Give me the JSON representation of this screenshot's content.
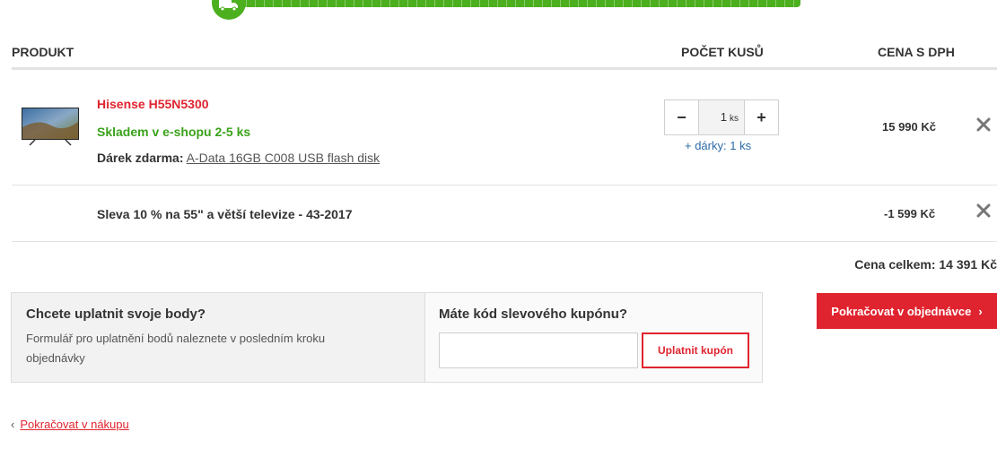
{
  "progress": {
    "step_icon": "truck-icon",
    "color": "#4caf1e",
    "fill": 1.0
  },
  "table_header": {
    "product": "PRODUKT",
    "quantity": "POČET KUSŮ",
    "price": "CENA S DPH"
  },
  "items": [
    {
      "name": "Hisense H55N5300",
      "stock": "Skladem v e-shopu 2-5 ks",
      "gift_label": "Dárek zdarma:",
      "gift_link": "A-Data 16GB C008 USB flash disk",
      "qty_minus": "−",
      "qty_value": "1",
      "qty_unit": "ks",
      "qty_plus": "+",
      "gifts_prefix": "+ dárky:",
      "gifts_count": "1 ks",
      "price": "15 990 Kč"
    }
  ],
  "discount": {
    "text": "Sleva 10 % na 55\" a větší televize - 43-2017",
    "price": "-1 599 Kč"
  },
  "total": "Cena celkem: 14 391 Kč",
  "points": {
    "title": "Chcete uplatnit svoje body?",
    "description": "Formulář pro uplatnění bodů naleznete v posledním kroku objednávky"
  },
  "coupon": {
    "title": "Máte kód slevového kupónu?",
    "input_value": "",
    "apply_label": "Uplatnit kupón"
  },
  "continue_order": {
    "label": "Pokračovat v objednávce",
    "chevron": "›"
  },
  "continue_shopping": {
    "chevron": "‹",
    "label": "Pokračovat v nákupu"
  },
  "colors": {
    "accent": "#e0242f",
    "stock_green": "#3aa21a",
    "link_blue": "#2b6aa5"
  }
}
